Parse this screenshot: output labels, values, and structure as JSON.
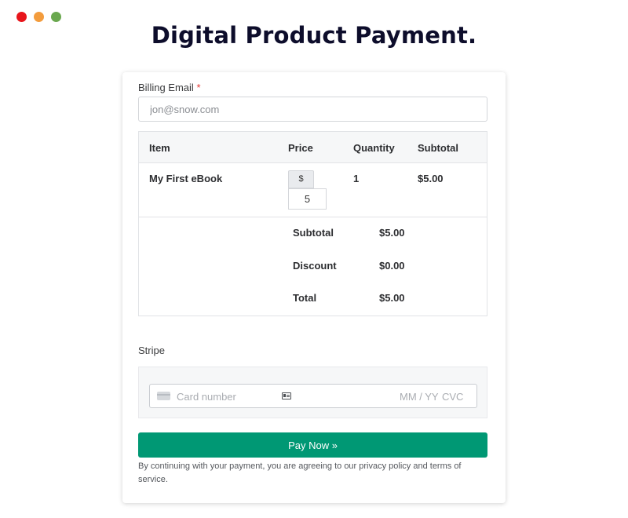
{
  "window": {
    "controls": [
      "close",
      "minimize",
      "maximize"
    ]
  },
  "page": {
    "title": "Digital Product Payment."
  },
  "billing": {
    "label": "Billing Email",
    "required_mark": "*",
    "placeholder": "jon@snow.com"
  },
  "table": {
    "headers": {
      "item": "Item",
      "price": "Price",
      "quantity": "Quantity",
      "subtotal": "Subtotal"
    },
    "row": {
      "item": "My First eBook",
      "currency": "$",
      "price_value": "5",
      "quantity": "1",
      "subtotal": "$5.00"
    },
    "summary": {
      "subtotal_label": "Subtotal",
      "subtotal_value": "$5.00",
      "discount_label": "Discount",
      "discount_value": "$0.00",
      "total_label": "Total",
      "total_value": "$5.00"
    }
  },
  "payment": {
    "method_label": "Stripe",
    "card_placeholder": "Card number",
    "expiry_placeholder": "MM / YY",
    "cvc_placeholder": "CVC"
  },
  "pay_button_label": "Pay Now »",
  "terms_text": "By continuing with your payment, you are agreeing to our privacy policy and terms of service.",
  "colors": {
    "accent": "#009874",
    "title": "#0d0d2b",
    "required": "#e53935"
  }
}
